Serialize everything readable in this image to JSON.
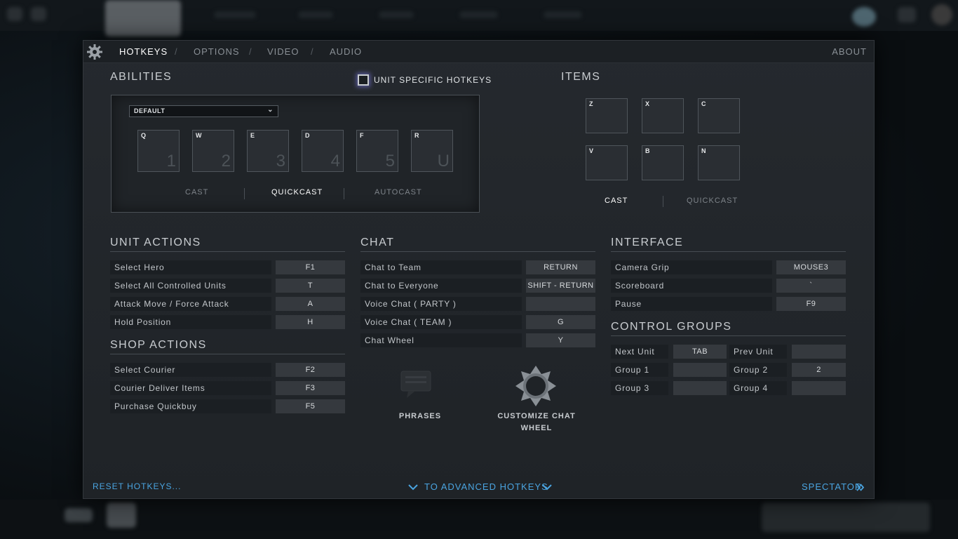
{
  "nav": {
    "tabs": [
      "HOTKEYS",
      "OPTIONS",
      "VIDEO",
      "AUDIO"
    ],
    "separator": "/",
    "about": "ABOUT"
  },
  "abilities": {
    "title": "ABILITIES",
    "unit_specific_label": "UNIT SPECIFIC HOTKEYS",
    "unit_specific_checked": false,
    "preset": "DEFAULT",
    "slots": [
      {
        "key": "Q",
        "num": "1"
      },
      {
        "key": "W",
        "num": "2"
      },
      {
        "key": "E",
        "num": "3"
      },
      {
        "key": "D",
        "num": "4"
      },
      {
        "key": "F",
        "num": "5"
      },
      {
        "key": "R",
        "num": "U"
      }
    ],
    "cast_modes": [
      "CAST",
      "QUICKCAST",
      "AUTOCAST"
    ],
    "active_mode": "QUICKCAST"
  },
  "items": {
    "title": "ITEMS",
    "slots": [
      "Z",
      "X",
      "C",
      "V",
      "B",
      "N"
    ],
    "cast_modes": [
      "CAST",
      "QUICKCAST"
    ],
    "active_mode": "CAST"
  },
  "unit_actions": {
    "title": "UNIT ACTIONS",
    "rows": [
      {
        "label": "Select Hero",
        "key": "F1"
      },
      {
        "label": "Select All Controlled Units",
        "key": "T"
      },
      {
        "label": "Attack Move / Force Attack",
        "key": "A"
      },
      {
        "label": "Hold Position",
        "key": "H"
      }
    ]
  },
  "shop_actions": {
    "title": "SHOP ACTIONS",
    "rows": [
      {
        "label": "Select Courier",
        "key": "F2"
      },
      {
        "label": "Courier Deliver Items",
        "key": "F3"
      },
      {
        "label": "Purchase Quickbuy",
        "key": "F5"
      }
    ]
  },
  "chat": {
    "title": "CHAT",
    "rows": [
      {
        "label": "Chat to Team",
        "key": "RETURN"
      },
      {
        "label": "Chat to Everyone",
        "key": "SHIFT - RETURN"
      },
      {
        "label": "Voice Chat ( PARTY )",
        "key": ""
      },
      {
        "label": "Voice Chat ( TEAM )",
        "key": "G"
      },
      {
        "label": "Chat Wheel",
        "key": "Y"
      }
    ],
    "phrases_label": "PHRASES",
    "customize_label_1": "CUSTOMIZE CHAT",
    "customize_label_2": "WHEEL"
  },
  "interface": {
    "title": "INTERFACE",
    "rows": [
      {
        "label": "Camera Grip",
        "key": "MOUSE3"
      },
      {
        "label": "Scoreboard",
        "key": "`"
      },
      {
        "label": "Pause",
        "key": "F9"
      }
    ]
  },
  "control_groups": {
    "title": "CONTROL GROUPS",
    "rows": [
      {
        "label": "Next Unit",
        "key": "TAB",
        "label2": "Prev Unit",
        "key2": ""
      },
      {
        "label": "Group 1",
        "key": "",
        "label2": "Group 2",
        "key2": "2"
      },
      {
        "label": "Group 3",
        "key": "",
        "label2": "Group 4",
        "key2": ""
      }
    ]
  },
  "footer": {
    "reset": "RESET HOTKEYS...",
    "advanced": "TO ADVANCED HOTKEYS",
    "spectator": "SPECTATOR"
  },
  "colors": {
    "accent": "#4aa4e0",
    "panel": "#23272b"
  }
}
